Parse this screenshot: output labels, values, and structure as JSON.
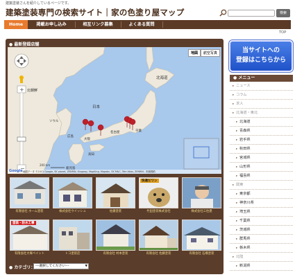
{
  "header": {
    "note": "建築塗装さんを紹介しているページです。",
    "title": "建築塗装専門の検索サイト｜家の色塗り屋マップ",
    "search_button": "検索"
  },
  "nav": {
    "items": [
      {
        "label": "Home"
      },
      {
        "label": "掲載お申し込み"
      },
      {
        "label": "相互リンク募集"
      },
      {
        "label": "よくある質問"
      }
    ]
  },
  "top_link": "TOP",
  "main": {
    "heading": "最新登録店舗",
    "map": {
      "type_buttons": [
        "地図",
        "航空写真"
      ],
      "labels": {
        "hokkaido": "北海道",
        "north_korea": "北朝鮮",
        "japan": "日本",
        "hiroshima": "広島",
        "nagoya": "名古屋",
        "chiba": "千葉",
        "osaka": "大阪",
        "kochi": "高知",
        "kagoshima": "鹿児島",
        "seoul": "ソウル",
        "scale_km": "200 km"
      },
      "google": "Google",
      "copyright": "地図データ ©2013 Google, SK planet, ZENRIN, Kingway, MapKing, Mapabc, SK M&C, Tele Atlas, ZENRIN - 利用規約"
    },
    "thumbs": [
      {
        "caption": "有限会社 ホーム塗装",
        "badge": ""
      },
      {
        "caption": "株式会社ウイッシュ",
        "badge": ""
      },
      {
        "caption": "佐藤塗装",
        "badge": ""
      },
      {
        "caption": "竹田塗装株式会社",
        "badge": "快適だワン"
      },
      {
        "caption": "株式会社三住建",
        "badge": ""
      },
      {
        "caption": "有限会社大塚ペイント",
        "badge": "塗装・防水工事"
      },
      {
        "caption": "トコ塗装店",
        "badge": ""
      },
      {
        "caption": "有限会社 村本塗装",
        "badge": ""
      },
      {
        "caption": "有限会社 佐藤塗装",
        "badge": ""
      },
      {
        "caption": "有限会社 石橋塗装",
        "badge": ""
      }
    ],
    "category_label": "カテゴリ：",
    "category_select": "---選択してください---"
  },
  "banner": {
    "line1": "当サイトへの",
    "line2": "登録はこちらから"
  },
  "menu": {
    "heading": "メニュー",
    "items": [
      {
        "label": "ニュース",
        "kind": "cat"
      },
      {
        "label": "コラム",
        "kind": "cat"
      },
      {
        "label": "求人",
        "kind": "cat"
      },
      {
        "label": "北海道・東北",
        "kind": "cat"
      },
      {
        "label": "北海道",
        "kind": "sub"
      },
      {
        "label": "青森県",
        "kind": "sub"
      },
      {
        "label": "岩手県",
        "kind": "sub"
      },
      {
        "label": "秋田県",
        "kind": "sub"
      },
      {
        "label": "宮城県",
        "kind": "sub"
      },
      {
        "label": "山形県",
        "kind": "sub"
      },
      {
        "label": "福島県",
        "kind": "sub"
      },
      {
        "label": "関東",
        "kind": "cat"
      },
      {
        "label": "東京都",
        "kind": "sub"
      },
      {
        "label": "神奈川県",
        "kind": "sub"
      },
      {
        "label": "埼玉県",
        "kind": "sub"
      },
      {
        "label": "千葉県",
        "kind": "sub"
      },
      {
        "label": "茨城県",
        "kind": "sub"
      },
      {
        "label": "群馬県",
        "kind": "sub"
      },
      {
        "label": "栃木県",
        "kind": "sub"
      },
      {
        "label": "北陸",
        "kind": "cat"
      },
      {
        "label": "新潟県",
        "kind": "sub"
      }
    ]
  }
}
